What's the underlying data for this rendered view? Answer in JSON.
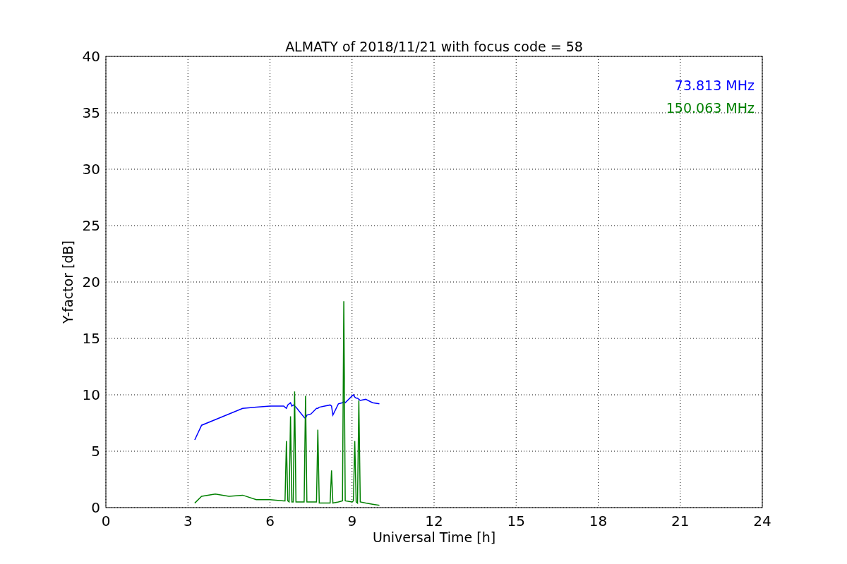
{
  "chart_data": {
    "type": "line",
    "title": "ALMATY of 2018/11/21 with focus code = 58",
    "xlabel": "Universal Time [h]",
    "ylabel": "Y-factor [dB]",
    "x": [
      3.25,
      3.5,
      4,
      4.5,
      5,
      5.5,
      6,
      6.5,
      6.55,
      6.6,
      6.65,
      6.7,
      6.75,
      6.8,
      6.85,
      6.9,
      6.95,
      7.25,
      7.3,
      7.35,
      7.5,
      7.7,
      7.75,
      7.8,
      8,
      8.2,
      8.25,
      8.3,
      8.5,
      8.65,
      8.7,
      8.75,
      9,
      9.05,
      9.1,
      9.15,
      9.2,
      9.25,
      9.3,
      9.5,
      9.75,
      10
    ],
    "series": [
      {
        "name": "73.813 MHz",
        "color": "#0000ff",
        "values": [
          6.0,
          7.3,
          7.8,
          8.3,
          8.8,
          8.9,
          9.0,
          9.0,
          8.9,
          8.8,
          9.1,
          9.2,
          9.3,
          9.0,
          9.1,
          9.0,
          8.9,
          8.0,
          7.9,
          8.2,
          8.3,
          8.8,
          8.8,
          8.9,
          9.0,
          9.1,
          9.0,
          8.2,
          9.2,
          9.3,
          9.4,
          9.3,
          9.9,
          10.0,
          9.8,
          9.7,
          9.7,
          9.6,
          9.5,
          9.6,
          9.3,
          9.2
        ]
      },
      {
        "name": "150.063 MHz",
        "color": "#008000",
        "values": [
          0.4,
          1.0,
          1.2,
          1.0,
          1.1,
          0.7,
          0.7,
          0.6,
          0.6,
          5.9,
          0.6,
          0.5,
          8.1,
          0.5,
          0.5,
          10.3,
          0.5,
          0.5,
          9.9,
          0.5,
          0.5,
          0.5,
          6.9,
          0.4,
          0.4,
          0.4,
          3.3,
          0.4,
          0.5,
          0.6,
          18.3,
          0.6,
          0.5,
          0.6,
          5.9,
          0.5,
          0.4,
          9.5,
          0.5,
          0.4,
          0.3,
          0.2
        ]
      }
    ],
    "grid": true,
    "xlim": [
      0,
      24
    ],
    "ylim": [
      0,
      40
    ],
    "xticks": [
      0,
      3,
      6,
      9,
      12,
      15,
      18,
      21,
      24
    ],
    "yticks": [
      0,
      5,
      10,
      15,
      20,
      25,
      30,
      35,
      40
    ]
  }
}
